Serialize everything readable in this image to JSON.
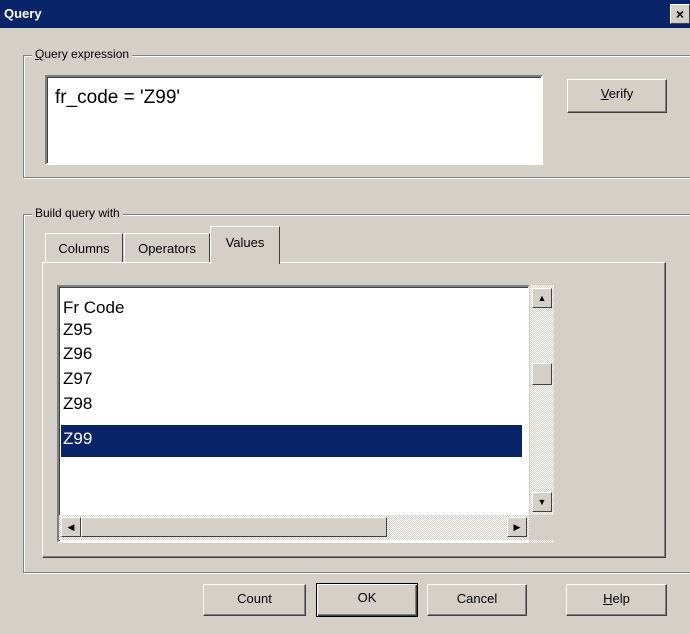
{
  "window": {
    "title": "Query",
    "close_glyph": "×"
  },
  "query_group": {
    "label_underlined": "Q",
    "label_rest": "uery expression",
    "expression": "fr_code = 'Z99'",
    "verify": {
      "underlined": "V",
      "rest": "erify"
    }
  },
  "build_group": {
    "label": "Build query with",
    "tabs": [
      {
        "label": "Columns",
        "active": false
      },
      {
        "label": "Operators",
        "active": false
      },
      {
        "label": "Values",
        "active": true
      }
    ],
    "values_list": {
      "items": [
        {
          "text": "Fr Code",
          "selected": false
        },
        {
          "text": "Z95",
          "selected": false
        },
        {
          "text": "Z96",
          "selected": false
        },
        {
          "text": "Z97",
          "selected": false
        },
        {
          "text": "Z98",
          "selected": false
        },
        {
          "text": "Z99",
          "selected": true
        }
      ],
      "scroll_up_glyph": "▲",
      "scroll_down_glyph": "▼",
      "scroll_left_glyph": "◀",
      "scroll_right_glyph": "▶"
    }
  },
  "buttons": {
    "count": "Count",
    "ok": "OK",
    "cancel": "Cancel",
    "help": {
      "underlined": "H",
      "rest": "elp"
    }
  },
  "colors": {
    "face": "#d4d0c8",
    "titlebar": "#0a246a",
    "selection": "#0a246a"
  }
}
